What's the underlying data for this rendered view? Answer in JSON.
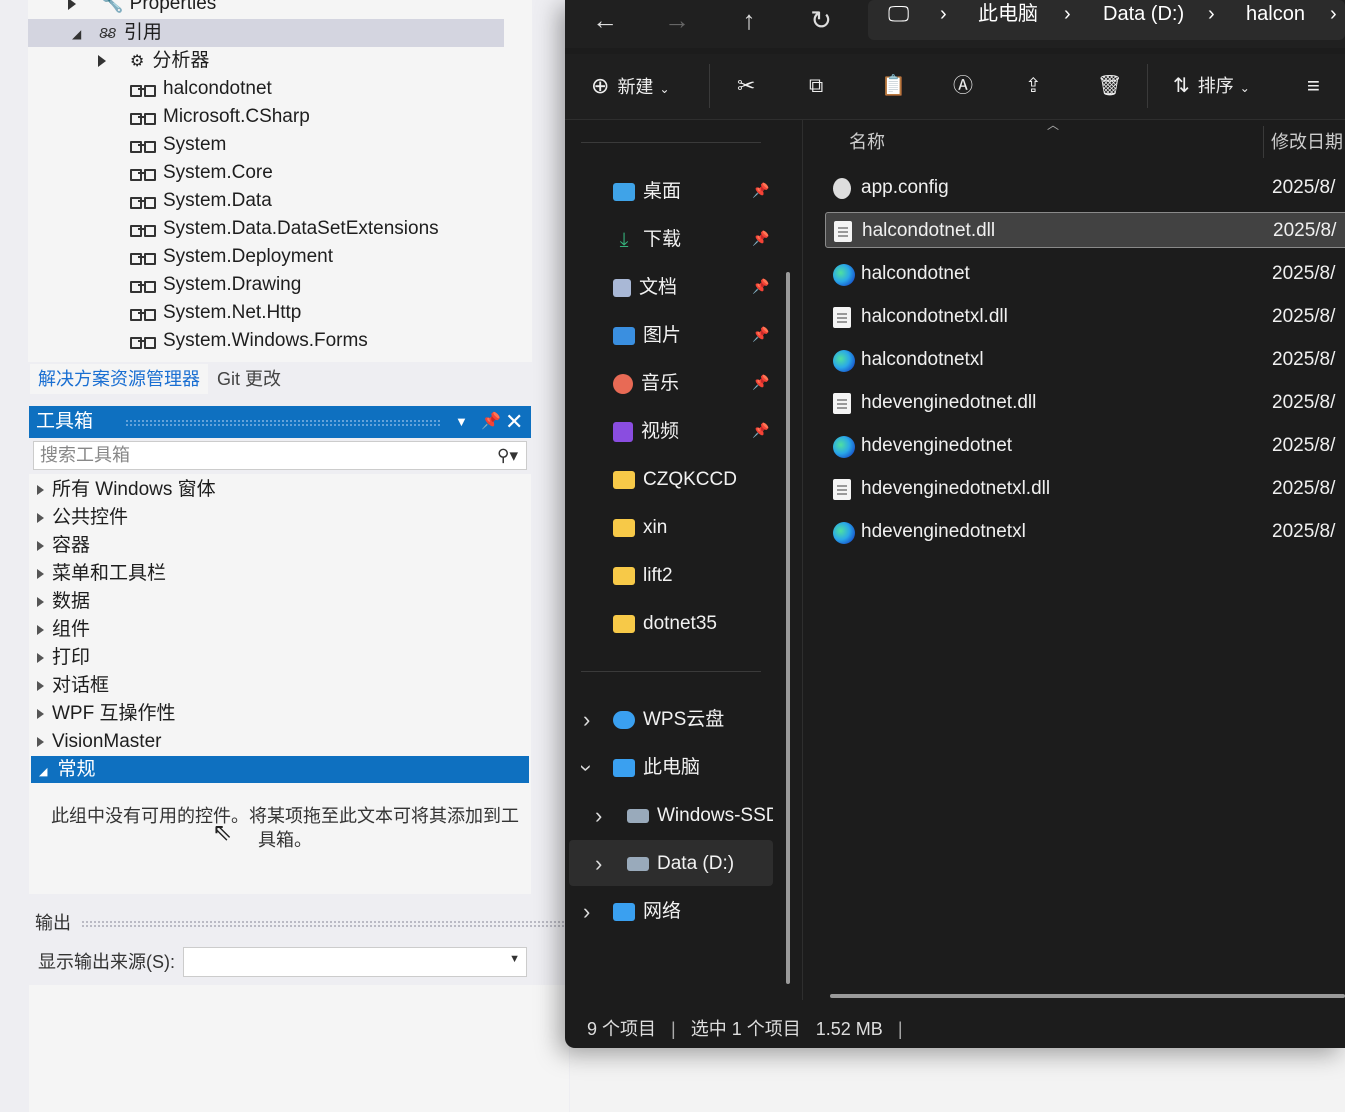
{
  "solution_explorer": {
    "tree": [
      {
        "label": "Properties"
      },
      {
        "label": "引用"
      },
      {
        "label": "分析器"
      },
      {
        "label": "halcondotnet"
      },
      {
        "label": "Microsoft.CSharp"
      },
      {
        "label": "System"
      },
      {
        "label": "System.Core"
      },
      {
        "label": "System.Data"
      },
      {
        "label": "System.Data.DataSetExtensions"
      },
      {
        "label": "System.Deployment"
      },
      {
        "label": "System.Drawing"
      },
      {
        "label": "System.Net.Http"
      },
      {
        "label": "System.Windows.Forms"
      }
    ],
    "tabs": [
      "解决方案资源管理器",
      "Git 更改"
    ]
  },
  "toolbox": {
    "title": "工具箱",
    "search_placeholder": "搜索工具箱",
    "categories": [
      "所有 Windows 窗体",
      "公共控件",
      "容器",
      "菜单和工具栏",
      "数据",
      "组件",
      "打印",
      "对话框",
      "WPF 互操作性",
      "VisionMaster"
    ],
    "selected": "常规",
    "empty_message": "此组中没有可用的控件。将某项拖至此文本可将其添加到工具箱。"
  },
  "output": {
    "title": "输出",
    "source_label": "显示输出来源(S):"
  },
  "explorer": {
    "address": [
      "此电脑",
      "Data (D:)",
      "halcon"
    ],
    "new_label": "新建",
    "sort_label": "排序",
    "sidebar": [
      {
        "label": "桌面",
        "icon": "desktop-icon",
        "color": "#3fa3e8",
        "pinned": true
      },
      {
        "label": "下载",
        "icon": "download-icon",
        "color": "#35b07a",
        "pinned": true
      },
      {
        "label": "文档",
        "icon": "document-icon",
        "color": "#a9b8d6",
        "pinned": true
      },
      {
        "label": "图片",
        "icon": "pictures-icon",
        "color": "#3a8fe0",
        "pinned": true
      },
      {
        "label": "音乐",
        "icon": "music-icon",
        "color": "#e86a55",
        "pinned": true
      },
      {
        "label": "视频",
        "icon": "video-icon",
        "color": "#8a4de0",
        "pinned": true
      },
      {
        "label": "CZQKCCD",
        "icon": "folder-icon",
        "color": "#f7c948"
      },
      {
        "label": "xin",
        "icon": "folder-icon",
        "color": "#f7c948"
      },
      {
        "label": "lift2",
        "icon": "folder-icon",
        "color": "#f7c948"
      },
      {
        "label": "dotnet35",
        "icon": "folder-icon",
        "color": "#f7c948"
      },
      {
        "label": "WPS云盘",
        "icon": "cloud-icon",
        "color": "#3aa0f0"
      },
      {
        "label": "此电脑",
        "icon": "pc-icon",
        "color": "#3aa0f0"
      },
      {
        "label": "Windows-SSD",
        "icon": "drive-icon",
        "color": "#9ab"
      },
      {
        "label": "Data (D:)",
        "icon": "drive-icon",
        "color": "#9ab"
      },
      {
        "label": "网络",
        "icon": "network-icon",
        "color": "#3aa0f0"
      }
    ],
    "columns": {
      "name": "名称",
      "modified": "修改日期"
    },
    "files": [
      {
        "name": "app.config",
        "date": "2025/8/",
        "icon": "config-file-icon"
      },
      {
        "name": "halcondotnet.dll",
        "date": "2025/8/",
        "icon": "dll-file-icon"
      },
      {
        "name": "halcondotnet",
        "date": "2025/8/",
        "icon": "edge-icon"
      },
      {
        "name": "halcondotnetxl.dll",
        "date": "2025/8/",
        "icon": "dll-file-icon"
      },
      {
        "name": "halcondotnetxl",
        "date": "2025/8/",
        "icon": "edge-icon"
      },
      {
        "name": "hdevenginedotnet.dll",
        "date": "2025/8/",
        "icon": "dll-file-icon"
      },
      {
        "name": "hdevenginedotnet",
        "date": "2025/8/",
        "icon": "edge-icon"
      },
      {
        "name": "hdevenginedotnetxl.dll",
        "date": "2025/8/",
        "icon": "dll-file-icon"
      },
      {
        "name": "hdevenginedotnetxl",
        "date": "2025/8/",
        "icon": "edge-icon"
      }
    ],
    "status": {
      "count": "9 个项目",
      "selection": "选中 1 个项目",
      "size": "1.52 MB"
    }
  }
}
